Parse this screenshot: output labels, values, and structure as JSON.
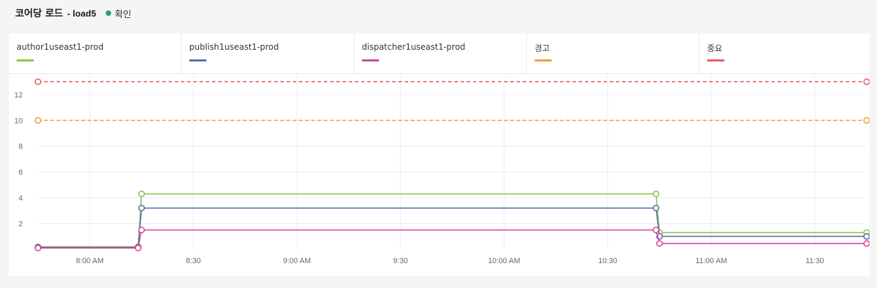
{
  "header": {
    "title": "코어당 로드",
    "subtitle": "- load5",
    "status": "확인"
  },
  "colors": {
    "author": "#8bc34a",
    "publish": "#5b6aa8",
    "dispatcher": "#d6419c",
    "warning": "#f0a030",
    "critical": "#ee5a5a",
    "status_ok": "#2d9d78"
  },
  "legend": [
    {
      "label": "author1useast1-prod",
      "color": "#8bc34a"
    },
    {
      "label": "publish1useast1-prod",
      "color": "#5b6aa8"
    },
    {
      "label": "dispatcher1useast1-prod",
      "color": "#d6419c"
    },
    {
      "label": "경고",
      "color": "#f0a030"
    },
    {
      "label": "중요",
      "color": "#ee5a5a"
    }
  ],
  "chart_data": {
    "type": "line",
    "xlim": [
      "07:45",
      "11:45"
    ],
    "ylim": [
      0,
      13.5
    ],
    "y_ticks": [
      "2",
      "4",
      "6",
      "8",
      "10",
      "12"
    ],
    "x_tick_labels": [
      "8:00 AM",
      "8:30",
      "9:00 AM",
      "9:30",
      "10:00 AM",
      "10:30",
      "11:00 AM",
      "11:30"
    ],
    "x_tick_times": [
      "08:00",
      "08:30",
      "09:00",
      "09:30",
      "10:00",
      "10:30",
      "11:00",
      "11:30"
    ],
    "grid": true,
    "series": [
      {
        "name": "author1useast1-prod",
        "color": "#8bc34a",
        "dashed": false,
        "points": [
          [
            "07:45",
            0.2
          ],
          [
            "08:14",
            0.2
          ],
          [
            "08:15",
            4.3
          ],
          [
            "10:44",
            4.3
          ],
          [
            "10:45",
            1.3
          ],
          [
            "11:45",
            1.3
          ]
        ]
      },
      {
        "name": "publish1useast1-prod",
        "color": "#5b6aa8",
        "dashed": false,
        "points": [
          [
            "07:45",
            0.15
          ],
          [
            "08:14",
            0.15
          ],
          [
            "08:15",
            3.2
          ],
          [
            "10:44",
            3.2
          ],
          [
            "10:45",
            1.0
          ],
          [
            "11:45",
            1.0
          ]
        ]
      },
      {
        "name": "dispatcher1useast1-prod",
        "color": "#d6419c",
        "dashed": false,
        "points": [
          [
            "07:45",
            0.1
          ],
          [
            "08:14",
            0.1
          ],
          [
            "08:15",
            1.5
          ],
          [
            "10:44",
            1.5
          ],
          [
            "10:45",
            0.45
          ],
          [
            "11:45",
            0.45
          ]
        ]
      },
      {
        "name": "경고",
        "color": "#f0a030",
        "dashed": true,
        "points": [
          [
            "07:45",
            10
          ],
          [
            "11:45",
            10
          ]
        ]
      },
      {
        "name": "중요",
        "color": "#ee5a5a",
        "dashed": true,
        "points": [
          [
            "07:45",
            13
          ],
          [
            "11:45",
            13
          ]
        ]
      }
    ]
  }
}
